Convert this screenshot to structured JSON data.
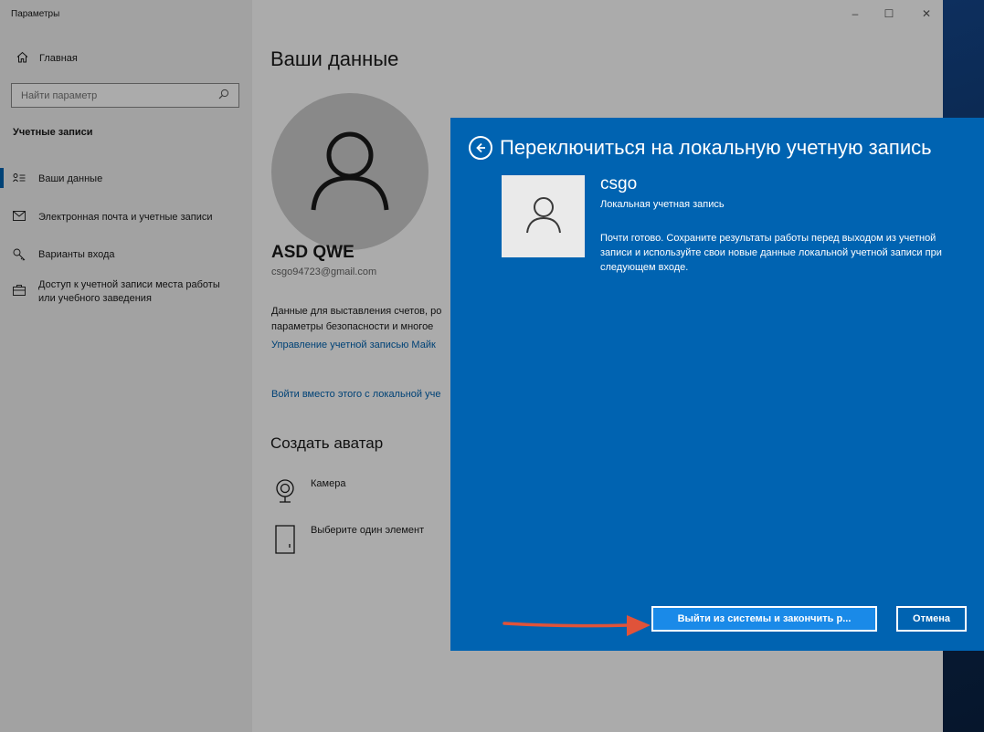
{
  "window": {
    "title": "Параметры",
    "controls": {
      "minimize": "–",
      "maximize": "☐",
      "close": "✕"
    }
  },
  "sidebar": {
    "home_label": "Главная",
    "search_placeholder": "Найти параметр",
    "section_heading": "Учетные записи",
    "items": [
      {
        "label": "Ваши данные",
        "icon": "person-list-icon",
        "selected": true
      },
      {
        "label": "Электронная почта и учетные записи",
        "icon": "mail-icon"
      },
      {
        "label": "Варианты входа",
        "icon": "key-icon"
      },
      {
        "label": "Доступ к учетной записи места работы",
        "label2": "или учебного заведения",
        "icon": "briefcase-icon"
      }
    ]
  },
  "main": {
    "title": "Ваши данные",
    "user_name": "ASD QWE",
    "user_email": "csgo94723@gmail.com",
    "description_line1": "Данные для выставления счетов, ро",
    "description_line2": "параметры безопасности и многое",
    "manage_link": "Управление учетной записью Майк",
    "local_link": "Войти вместо этого с локальной уче",
    "avatar_heading": "Создать аватар",
    "camera_label": "Камера",
    "choose_label": "Выберите один элемент"
  },
  "dialog": {
    "title": "Переключиться на локальную учетную запись",
    "account_name": "csgo",
    "account_type": "Локальная учетная запись",
    "message": "Почти готово. Сохраните результаты работы перед выходом из учетной записи и используйте свои новые данные локальной учетной записи при следующем входе.",
    "primary_button": "Выйти из системы и закончить р...",
    "cancel_button": "Отмена",
    "background_color": "#0063b1"
  },
  "annotation": {
    "arrow_color": "#e0533a"
  }
}
